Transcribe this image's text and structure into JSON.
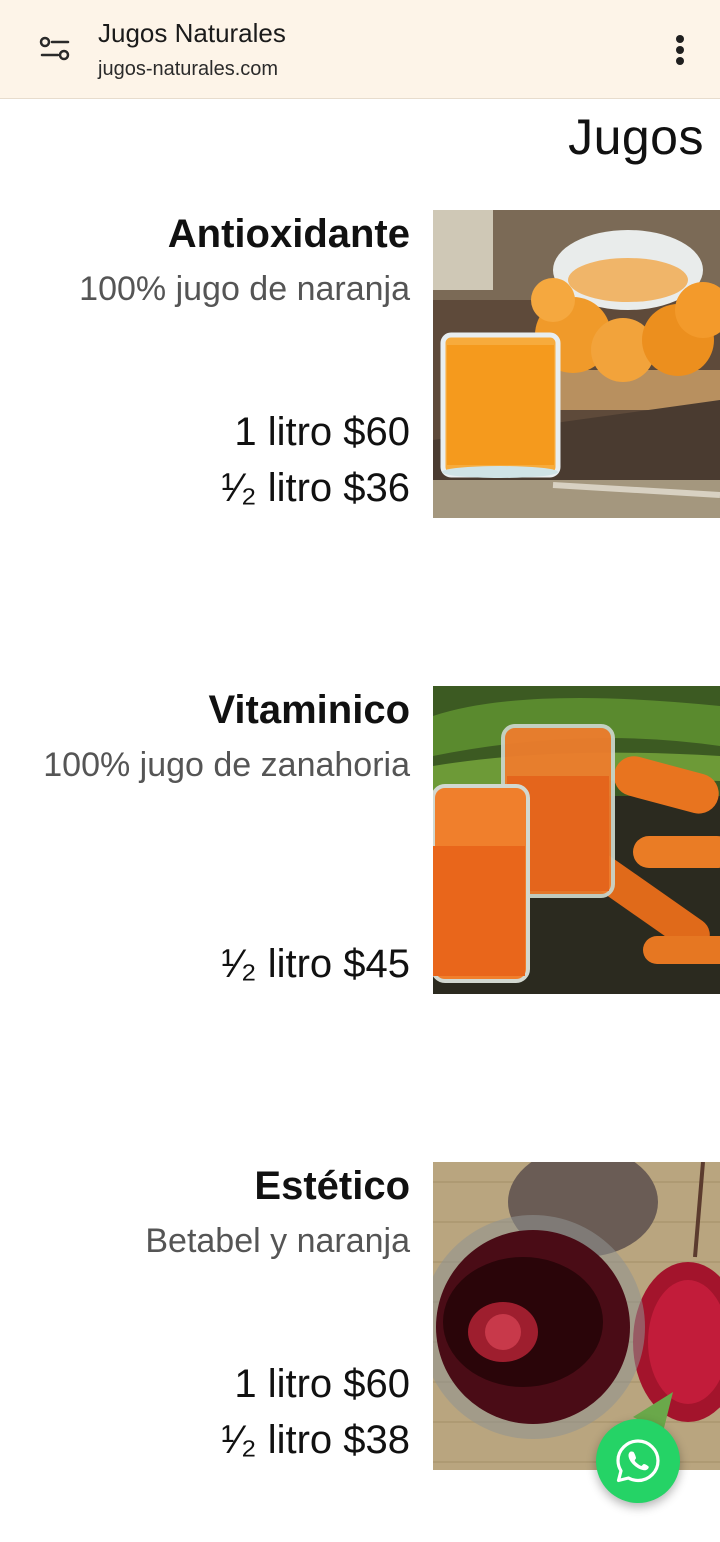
{
  "browser": {
    "site_title": "Jugos Naturales",
    "site_url": "jugos-naturales.com",
    "settings_icon": "tune-icon",
    "menu_icon": "more-vert-icon"
  },
  "page": {
    "heading": "Jugos"
  },
  "products": [
    {
      "name": "Antioxidante",
      "description": "100% jugo de naranja",
      "prices": [
        "1 litro $60",
        "¹⁄₂ litro $36"
      ],
      "image": "orange-juice-photo"
    },
    {
      "name": "Vitaminico",
      "description": "100% jugo de zanahoria",
      "prices": [
        "¹⁄₂ litro $45"
      ],
      "image": "carrot-juice-photo"
    },
    {
      "name": "Estético",
      "description": "Betabel y naranja",
      "prices": [
        "1 litro $60",
        "¹⁄₂ litro $38"
      ],
      "image": "beet-juice-photo"
    }
  ],
  "fab": {
    "icon": "whatsapp-icon",
    "color": "#25d366"
  }
}
